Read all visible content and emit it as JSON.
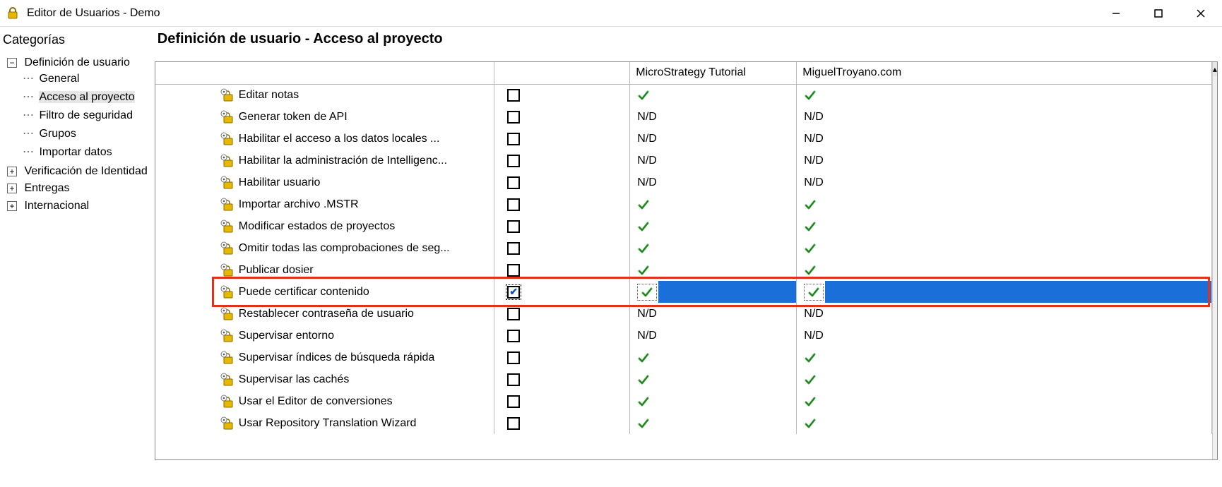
{
  "window": {
    "title": "Editor de Usuarios - Demo"
  },
  "sidebar": {
    "heading": "Categorías",
    "root": {
      "label": "Definición de usuario",
      "expanded": true,
      "children": [
        {
          "label": "General"
        },
        {
          "label": "Acceso al proyecto",
          "selected": true
        },
        {
          "label": "Filtro de seguridad"
        },
        {
          "label": "Grupos"
        },
        {
          "label": "Importar datos"
        }
      ]
    },
    "siblings": [
      {
        "label": "Verificación de Identidad",
        "expanded": false
      },
      {
        "label": "Entregas",
        "expanded": false
      },
      {
        "label": "Internacional",
        "expanded": false
      }
    ]
  },
  "main": {
    "title": "Definición de usuario - Acceso al proyecto",
    "columns": {
      "name": "",
      "checkbox": "",
      "project1": "MicroStrategy Tutorial",
      "project2": "MiguelTroyano.com"
    },
    "rows": [
      {
        "label": "Editar notas",
        "checked": false,
        "p1": "check",
        "p2": "check"
      },
      {
        "label": "Generar token de API",
        "checked": false,
        "p1": "N/D",
        "p2": "N/D"
      },
      {
        "label": "Habilitar el acceso a los datos locales ...",
        "checked": false,
        "p1": "N/D",
        "p2": "N/D"
      },
      {
        "label": "Habilitar la administración de Intelligenc...",
        "checked": false,
        "p1": "N/D",
        "p2": "N/D"
      },
      {
        "label": "Habilitar usuario",
        "checked": false,
        "p1": "N/D",
        "p2": "N/D"
      },
      {
        "label": "Importar archivo .MSTR",
        "checked": false,
        "p1": "check",
        "p2": "check"
      },
      {
        "label": "Modificar estados de proyectos",
        "checked": false,
        "p1": "check",
        "p2": "check"
      },
      {
        "label": "Omitir todas las comprobaciones de seg...",
        "checked": false,
        "p1": "check",
        "p2": "check"
      },
      {
        "label": "Publicar dosier",
        "checked": false,
        "p1": "check",
        "p2": "check"
      },
      {
        "label": "Puede certificar contenido",
        "checked": true,
        "selected": true,
        "p1": "check",
        "p2": "check"
      },
      {
        "label": "Restablecer contraseña de usuario",
        "checked": false,
        "p1": "N/D",
        "p2": "N/D"
      },
      {
        "label": "Supervisar entorno",
        "checked": false,
        "p1": "N/D",
        "p2": "N/D"
      },
      {
        "label": "Supervisar índices de búsqueda rápida",
        "checked": false,
        "p1": "check",
        "p2": "check"
      },
      {
        "label": "Supervisar las cachés",
        "checked": false,
        "p1": "check",
        "p2": "check"
      },
      {
        "label": "Usar el Editor de conversiones",
        "checked": false,
        "p1": "check",
        "p2": "check"
      },
      {
        "label": "Usar Repository Translation Wizard",
        "checked": false,
        "p1": "check",
        "p2": "check"
      }
    ]
  }
}
